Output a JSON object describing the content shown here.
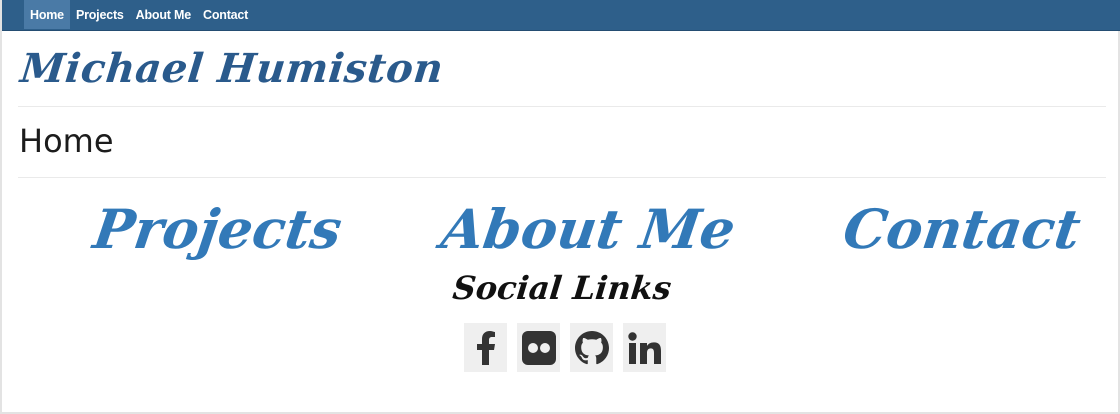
{
  "nav": {
    "items": [
      {
        "label": "Home",
        "active": true
      },
      {
        "label": "Projects",
        "active": false
      },
      {
        "label": "About Me",
        "active": false
      },
      {
        "label": "Contact",
        "active": false
      }
    ]
  },
  "site": {
    "title": "Michael Humiston"
  },
  "page": {
    "heading": "Home"
  },
  "links": {
    "projects": "Projects",
    "about": "About Me",
    "contact": "Contact"
  },
  "social": {
    "title": "Social Links",
    "items": [
      {
        "icon": "facebook-icon"
      },
      {
        "icon": "flickr-icon"
      },
      {
        "icon": "github-icon"
      },
      {
        "icon": "linkedin-icon"
      }
    ]
  },
  "colors": {
    "navbar": "#2e5f8a",
    "navbar_active": "#4a7aa6",
    "title": "#2a5a8c",
    "link": "#3279b8",
    "social_bg": "#efefef",
    "social_icon": "#333333"
  }
}
